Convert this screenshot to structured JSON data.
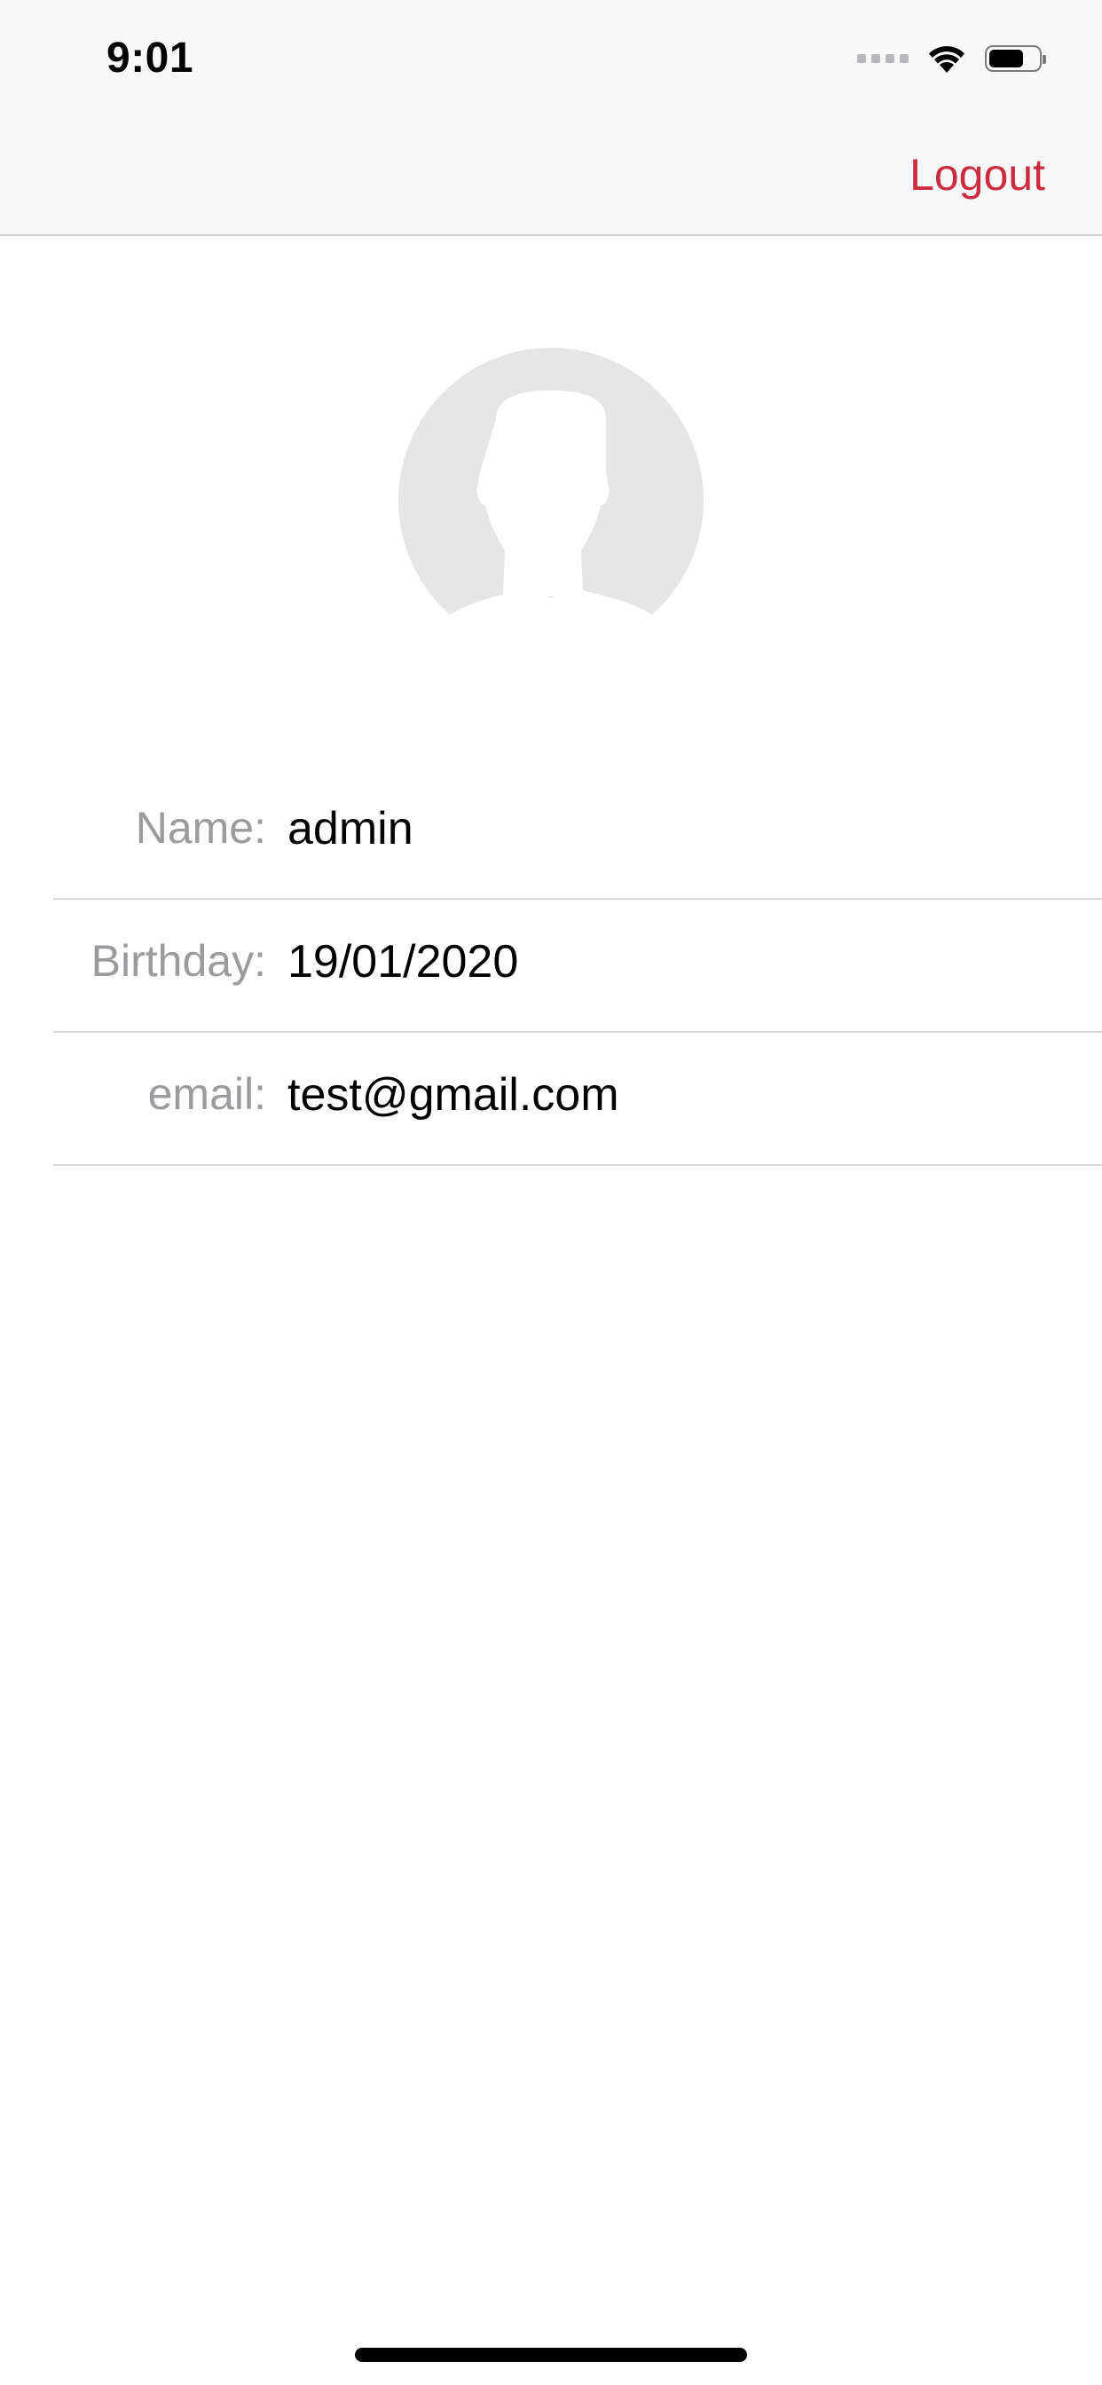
{
  "status_bar": {
    "time": "9:01",
    "icons": [
      "cellular-signal-icon",
      "wifi-icon",
      "battery-icon"
    ],
    "battery_level": 0.7
  },
  "nav": {
    "logout_label": "Logout"
  },
  "avatar": {
    "icon": "person-silhouette-icon"
  },
  "profile": {
    "fields": [
      {
        "label": "Name:",
        "value": "admin"
      },
      {
        "label": "Birthday:",
        "value": "19/01/2020"
      },
      {
        "label": "email:",
        "value": "test@gmail.com"
      }
    ]
  },
  "colors": {
    "accent": "#cc2c3f",
    "label_gray": "#9b9b9f",
    "separator": "#dadade",
    "avatar_bg": "#e6e6e6"
  }
}
